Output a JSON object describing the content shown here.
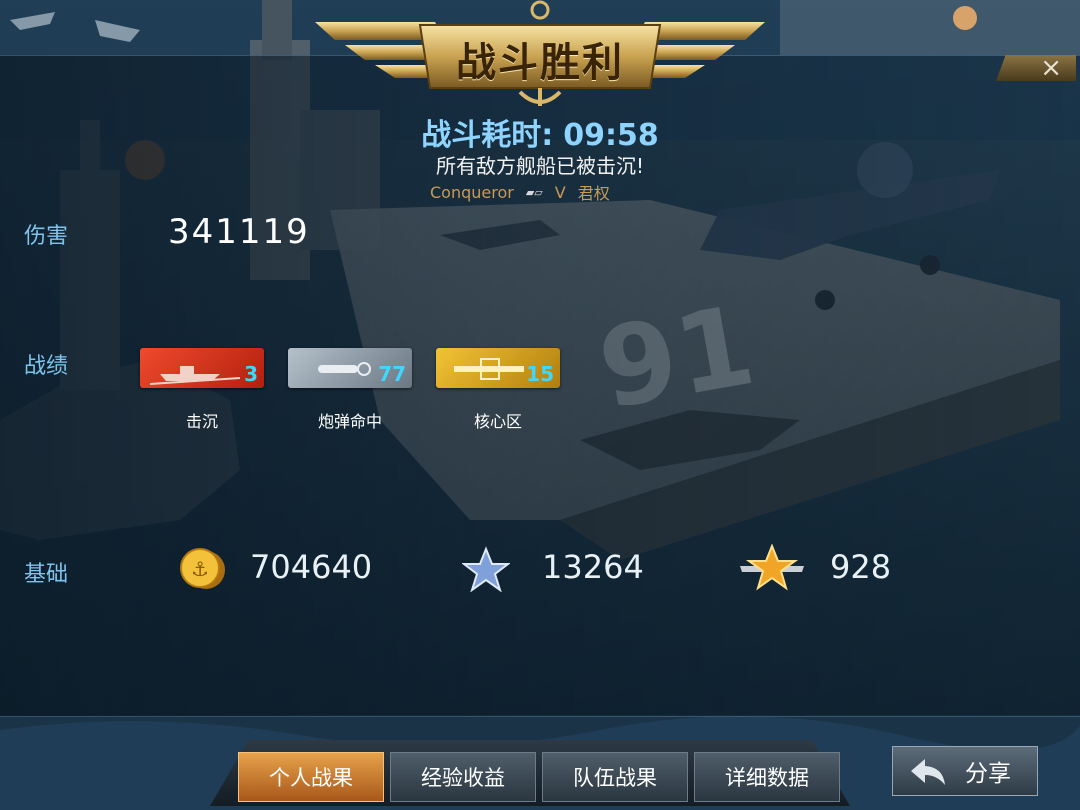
{
  "header": {
    "title": "战斗胜利",
    "close_symbol": "×",
    "battle_time_label": "战斗耗时:",
    "battle_time_value": "09:58",
    "result_message": "所有敌方舰船已被击沉!",
    "player_name": "Conqueror",
    "rank": "V",
    "ship_name": "君权"
  },
  "stats": {
    "damage_label": "伤害",
    "damage_value": "341119",
    "record_label": "战绩",
    "medals": [
      {
        "icon": "sunk-ship-icon",
        "count": "3",
        "label": "击沉",
        "color": "#d8341f",
        "count_color": "#3fd6ff"
      },
      {
        "icon": "shell-hit-icon",
        "count": "77",
        "label": "炮弹命中",
        "color": "#8b97a2",
        "count_color": "#3fd6ff"
      },
      {
        "icon": "citadel-icon",
        "count": "15",
        "label": "核心区",
        "color": "#d9a01f",
        "count_color": "#3fd6ff"
      }
    ],
    "base_label": "基础",
    "base": {
      "coins": "704640",
      "experience": "13264",
      "commander_xp": "928"
    }
  },
  "tabs": [
    {
      "label": "个人战果",
      "active": true
    },
    {
      "label": "经验收益",
      "active": false
    },
    {
      "label": "队伍战果",
      "active": false
    },
    {
      "label": "详细数据",
      "active": false
    }
  ],
  "share_label": "分享",
  "colors": {
    "accent_blue": "#7fc4ee",
    "tab_active": "#d88a35",
    "gold": "#c79a55"
  }
}
